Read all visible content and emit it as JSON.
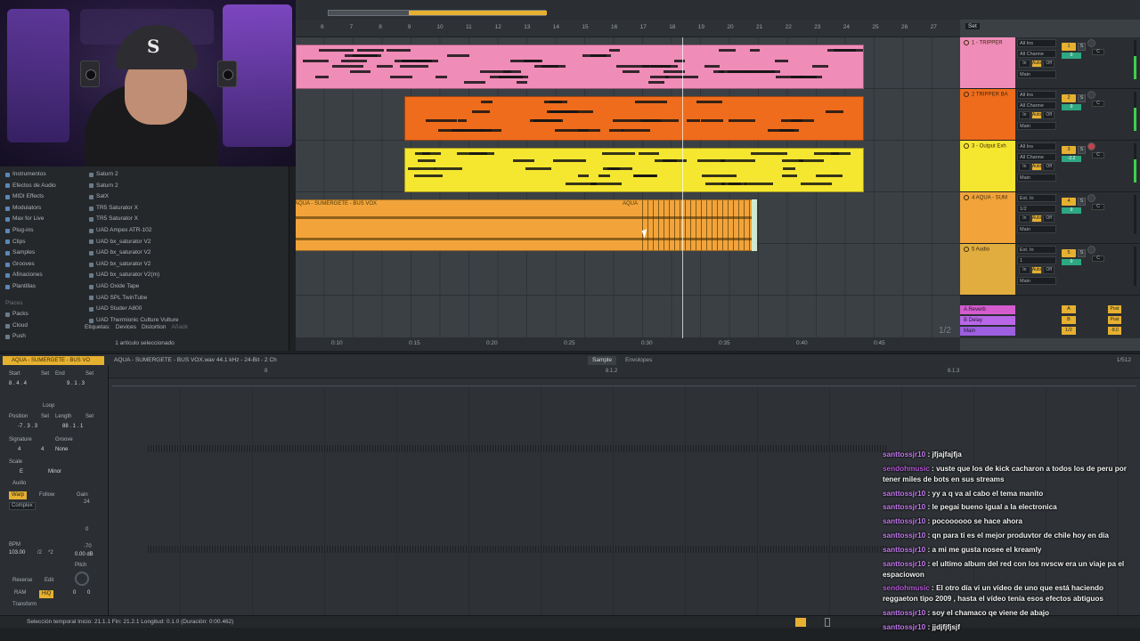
{
  "browser": {
    "categories": [
      "Instrumentos",
      "Efectos de Audio",
      "MIDI Effects",
      "Modulators",
      "Max for Live",
      "Plug-ins",
      "Clips",
      "Samples",
      "Grooves",
      "Afinaciones",
      "Plantillas"
    ],
    "places_label": "Places",
    "places": [
      "Packs",
      "Cloud",
      "Push"
    ],
    "items": [
      "Saturn 2",
      "Saturn 2",
      "SatX",
      "TR5 Saturator X",
      "TR5 Saturator X",
      "UAD Ampex ATR-102",
      "UAD bx_saturator V2",
      "UAD bx_saturator V2",
      "UAD bx_saturator V2",
      "UAD bx_saturator V2(m)",
      "UAD Oxide Tape",
      "UAD SPL TwinTube",
      "UAD Studer A800",
      "UAD Thermionic Culture Vulture"
    ],
    "tags_label": "Etiquetas:",
    "tags_devices": "Devices",
    "tags_path": "Distortion",
    "tags_add": "Añadir",
    "status": "1 artículo seleccionado"
  },
  "arrangement": {
    "bar_numbers": [
      "6",
      "7",
      "8",
      "9",
      "10",
      "11",
      "12",
      "13",
      "14",
      "15",
      "16",
      "17",
      "18",
      "19",
      "20",
      "21",
      "22",
      "23",
      "24",
      "25",
      "26",
      "27"
    ],
    "time_labels": [
      "0:10",
      "0:15",
      "0:20",
      "0:25",
      "0:30",
      "0:35",
      "0:40",
      "0:45"
    ],
    "zoom_fraction": "1/2",
    "set_label": "Set",
    "audio_clip_name": "AQUA - SUMERGETE - BUS VOX",
    "audio_clip_name_right": "AQUA"
  },
  "tracks": [
    {
      "name": "1 - TRIPPER",
      "color": "#f08cb8",
      "input": "All Ins",
      "channel": "All Channe",
      "in": "In",
      "auto": "Auto",
      "off": "Off",
      "out": "Main",
      "number": "1",
      "vol": "0",
      "pan": "C"
    },
    {
      "name": "2 TRIPPER BA",
      "color": "#ef6c1c",
      "input": "All Ins",
      "channel": "All Channe",
      "in": "In",
      "auto": "Auto",
      "off": "Off",
      "out": "Main",
      "number": "2",
      "vol": "0",
      "pan": "C"
    },
    {
      "name": "3 - Output Exh",
      "color": "#f5e630",
      "input": "All Ins",
      "channel": "All Channe",
      "in": "In",
      "auto": "Auto",
      "off": "Off",
      "out": "Main",
      "number": "3",
      "vol": "-2.2",
      "pan": "C"
    },
    {
      "name": "4 AQUA - SUM",
      "color": "#f2a43a",
      "input": "Ext. In",
      "channel": "1/2",
      "in": "In",
      "auto": "Auto",
      "off": "Off",
      "out": "Main",
      "number": "4",
      "vol": "0",
      "pan": "C"
    },
    {
      "name": "5 Audio",
      "color": "#e0ad3e",
      "input": "Ext. In",
      "channel": "1",
      "in": "In",
      "auto": "Auto",
      "off": "Off",
      "out": "Main",
      "number": "5",
      "vol": "0",
      "pan": "C"
    }
  ],
  "returns": [
    {
      "name": "A Reverb",
      "color": "#d45ccd",
      "letter": "A",
      "post": "Post"
    },
    {
      "name": "B Delay",
      "color": "#b967e8",
      "letter": "B",
      "post": "Post"
    },
    {
      "name": "Main",
      "color": "#9d5fe0",
      "letter": "1/2",
      "post": "-8.0"
    }
  ],
  "detail": {
    "clip_title": "AQUA - SUMERGETE - BUS VO",
    "sample_info": "AQUA - SUMERGETE - BUS VOX.wav  44.1 kHz - 24-Bit - 2 Ch",
    "tab_sample": "Sample",
    "tab_envelopes": "Envolopes",
    "page_fraction": "1/512",
    "ruler_marks": [
      "8",
      "8.1.2",
      "8.1.3"
    ],
    "start_label": "Start",
    "end_label": "End",
    "set": "Set",
    "start_value": "8 . 4 . 4",
    "end_value": "9 . 1 . 3",
    "loop_label": "Loop",
    "position_label": "Position",
    "length_label": "Length",
    "position_value": "-7 . 3 . 3",
    "length_value": "88 . 1 . 1",
    "signature_label": "Signature",
    "groove_label": "Groove",
    "sig_num": "4",
    "sig_den": "4",
    "groove_value": "None",
    "scale_label": "Scale",
    "scale_root": "E",
    "scale_mode": "Minor",
    "audio_label": "Audio",
    "warp": "Warp",
    "follow": "Follow",
    "gain_label": "Gain",
    "warp_mode": "Complex",
    "gain_max": "24",
    "gain_zero": "0",
    "gain_min": "-70",
    "gain_value": "0.00 dB",
    "bpm_label": "BPM",
    "bpm_value": "103.00",
    "half": "/2",
    "double": "*2",
    "pitch_label": "Pitch",
    "reverse": "Reverse",
    "edit": "Edit",
    "ram": "RAM",
    "hiq": "HiQ",
    "pitch_value": "0",
    "pitch_zero": "0",
    "transform": "Transform"
  },
  "status": {
    "selection": "Selección temporal    Inicio: 21.1.1    Fin: 21.2.1    Longitud: 0.1.0  (Duración: 0:00.462)"
  },
  "chat": [
    {
      "user": "santtossjr10",
      "text": "jfjajfajfja"
    },
    {
      "user": "sendohmusic",
      "text": "vuste que los de kick cacharon a todos los de peru por tener miles de bots en sus streams"
    },
    {
      "user": "santtossjr10",
      "text": "yy a q va al cabo el tema manito"
    },
    {
      "user": "santtossjr10",
      "text": "le pegai bueno igual a la electronica"
    },
    {
      "user": "santtossjr10",
      "text": "pocoooooo se hace ahora"
    },
    {
      "user": "santtossjr10",
      "text": "qn para ti es el mejor produvtor de chile hoy en dia"
    },
    {
      "user": "santtossjr10",
      "text": "a mi me gusta nosee el kreamly"
    },
    {
      "user": "santtossjr10",
      "text": "el ultimo album del red con los nvscw era un viaje pa el espaciowon"
    },
    {
      "user": "sendohmusic",
      "text": "El otro día vi un vídeo de uno que está haciendo reggaeton tipo 2009 , hasta el vídeo tenía esos efectos abtiguos"
    },
    {
      "user": "santtossjr10",
      "text": "soy el chamaco qe viene de abajo"
    },
    {
      "user": "santtossjr10",
      "text": "jjdjfjfjsjf"
    }
  ],
  "colors": {
    "accent": "#e6b030",
    "pink": "#f08cb8",
    "orange": "#ef6c1c",
    "yellow": "#f5e630",
    "audio": "#f2a43a"
  }
}
